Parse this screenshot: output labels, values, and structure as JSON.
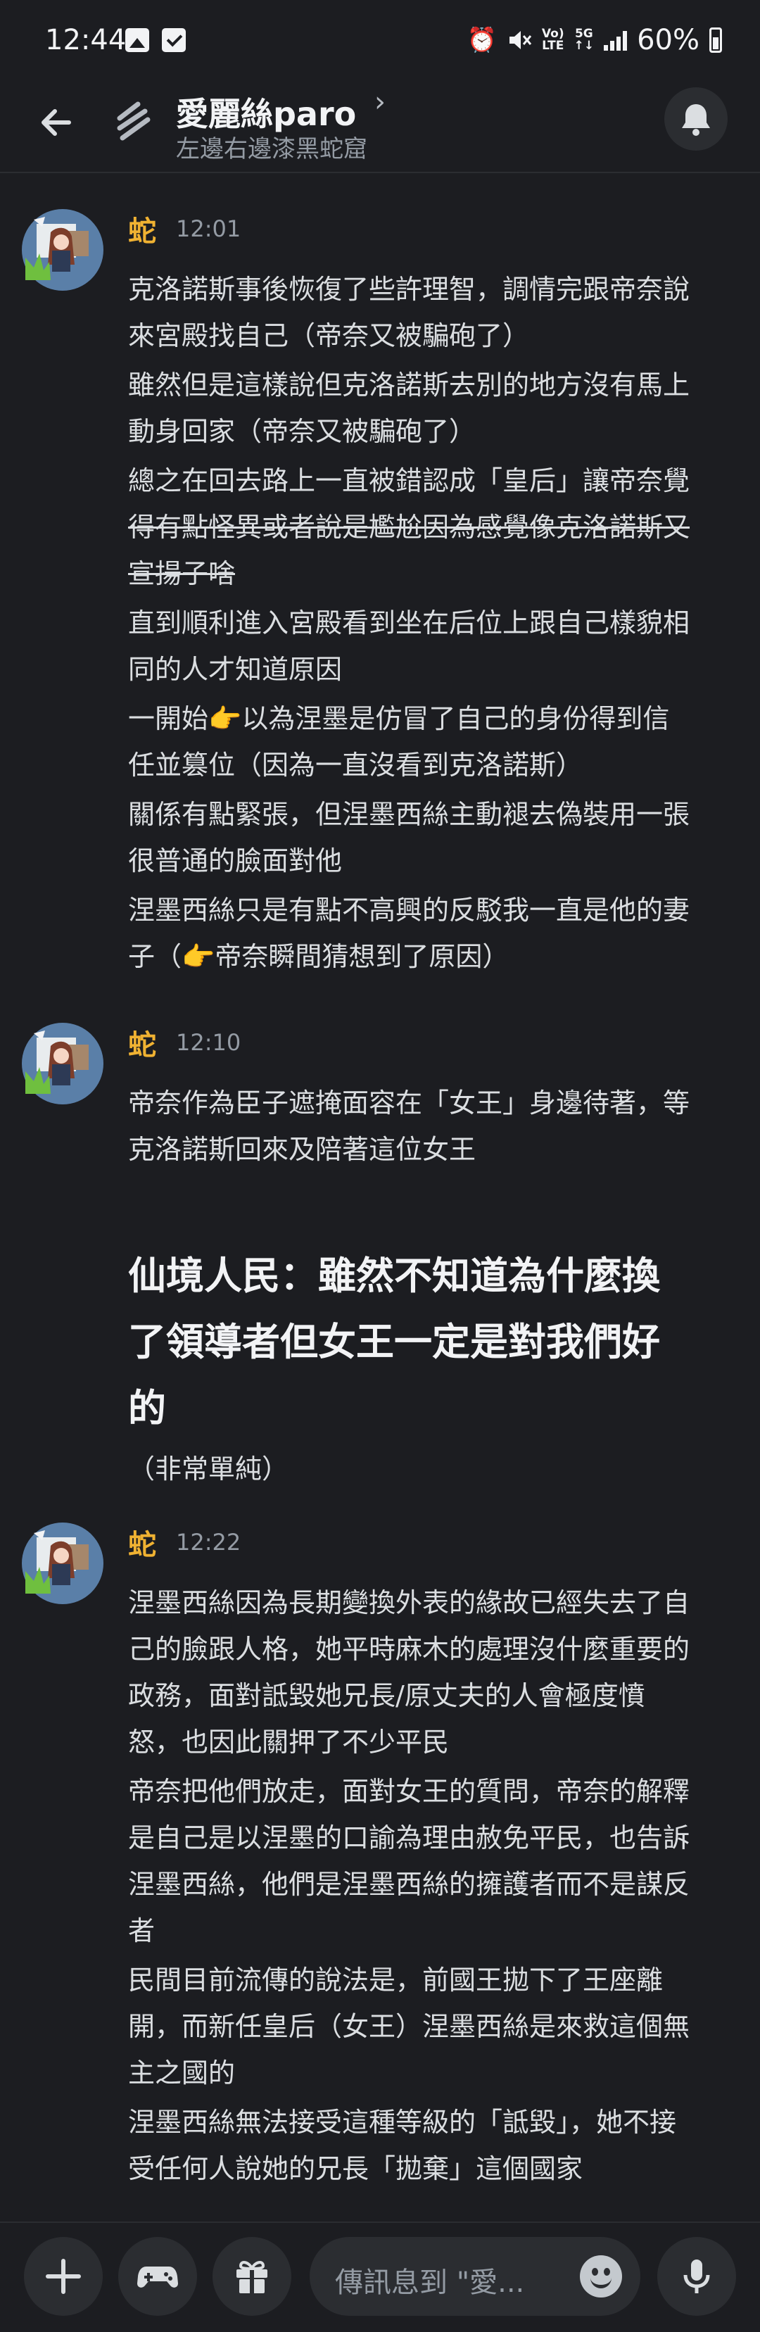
{
  "status_bar": {
    "time": "12:44",
    "network_top": "Vo)",
    "network_bottom": "LTE",
    "data_top": "5G",
    "data_bottom": "↑↓",
    "battery": "60%"
  },
  "header": {
    "channel_name": "愛麗絲paro",
    "chevron": "›",
    "subtitle": "左邊右邊漆黑蛇窟"
  },
  "messages": [
    {
      "author": "蛇",
      "time": "12:01",
      "lines": [
        "克洛諾斯事後恢復了些許理智，調情完跟帝奈說",
        "來宮殿找自己（帝奈又被騙砲了）",
        "雖然但是這樣說但克洛諾斯去別的地方沒有馬上",
        "動身回家（帝奈又被騙砲了）",
        "總之在回去路上一直被錯認成「皇后」讓帝奈覺",
        "得有點怪異或者說是尷尬因為感覺像克洛諾斯又",
        "宣揚子啥",
        "直到順利進入宮殿看到坐在后位上跟自己樣貌相",
        "同的人才知道原因",
        "一開始",
        "以為涅墨是仿冒了自己的身份得到信",
        "任並篡位（因為一直沒看到克洛諾斯）",
        "關係有點緊張，但涅墨西絲主動褪去偽裝用一張",
        "很普通的臉面對他",
        "涅墨西絲只是有點不高興的反駁我一直是他的妻",
        "子（",
        "帝奈瞬間猜想到了原因）"
      ]
    },
    {
      "author": "蛇",
      "time": "12:10",
      "lines": [
        "帝奈作為臣子遮掩面容在「女王」身邊待著，等",
        "克洛諾斯回來及陪著這位女王"
      ],
      "heading_lines": [
        "仙境人民：雖然不知道為什麼換",
        "了領導者但女王一定是對我們好",
        "的"
      ],
      "note": "（非常單純）"
    },
    {
      "author": "蛇",
      "time": "12:22",
      "lines": [
        "涅墨西絲因為長期變換外表的緣故已經失去了自",
        "己的臉跟人格，她平時麻木的處理沒什麼重要的",
        "政務，面對詆毀她兄長/原丈夫的人會極度憤",
        "怒，也因此關押了不少平民",
        "帝奈把他們放走，面對女王的質問，帝奈的解釋",
        "是自己是以涅墨的口諭為理由赦免平民，也告訴",
        "涅墨西絲，他們是涅墨西絲的擁護者而不是謀反",
        "者",
        "民間目前流傳的說法是，前國王拋下了王座離",
        "開，而新任皇后（女王）涅墨西絲是來救這個無",
        "主之國的",
        "涅墨西絲無法接受這種等級的「詆毀」，她不接",
        "受任何人說她的兄長「拋棄」這個國家"
      ]
    }
  ],
  "hand_emoji": "👉",
  "input": {
    "placeholder": "傳訊息到 \"愛..."
  }
}
